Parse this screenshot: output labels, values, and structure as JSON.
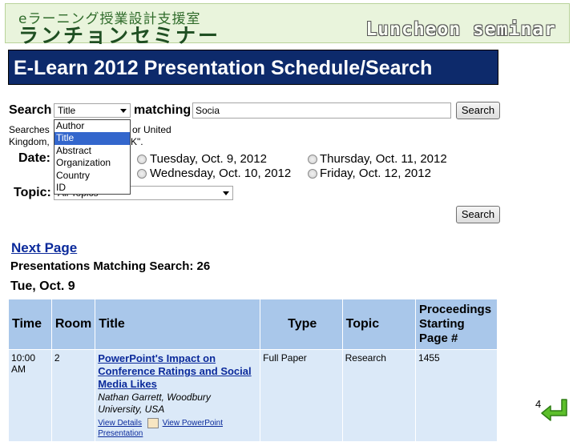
{
  "banner": {
    "jp_sub": "eラーニング授業設計支援室",
    "jp_main": "ランチョンセミナー",
    "en": "Luncheon seminar"
  },
  "page_title": "E-Learn 2012 Presentation Schedule/Search",
  "search": {
    "label": "Search",
    "field_value": "Title",
    "matching_label": "matching",
    "query": "Socia",
    "button": "Search",
    "hint_line1_prefix": "Searches",
    "hint_line1_suffix": "or United",
    "hint_line2_prefix": "Kingdom,",
    "hint_line2_suffix": "K\".",
    "dropdown_options": [
      "Author",
      "Title",
      "Abstract",
      "Organization",
      "Country",
      "ID"
    ]
  },
  "date": {
    "label": "Date:",
    "options": [
      "Tuesday, Oct. 9, 2012",
      "Wednesday, Oct. 10, 2012",
      "Thursday, Oct. 11, 2012",
      "Friday, Oct. 12, 2012"
    ]
  },
  "topic": {
    "label": "Topic:",
    "value": "All Topics"
  },
  "search_button2": "Search",
  "next_page": "Next Page",
  "match_count": "Presentations Matching Search: 26",
  "day_heading": "Tue, Oct. 9",
  "table": {
    "headers": [
      "Time",
      "Room",
      "Title",
      "Type",
      "Topic",
      "Proceedings Starting Page #"
    ],
    "rows": [
      {
        "time": "10:00 AM",
        "room": "2",
        "title": "PowerPoint's Impact on Conference Ratings and Social Media Likes",
        "author": "Nathan Garrett, Woodbury University, USA",
        "link1": "View Details",
        "link2": "View PowerPoint",
        "link3": "Presentation",
        "type": "Full Paper",
        "topic": "Research",
        "page": "1455"
      }
    ]
  },
  "slide_number": "4"
}
